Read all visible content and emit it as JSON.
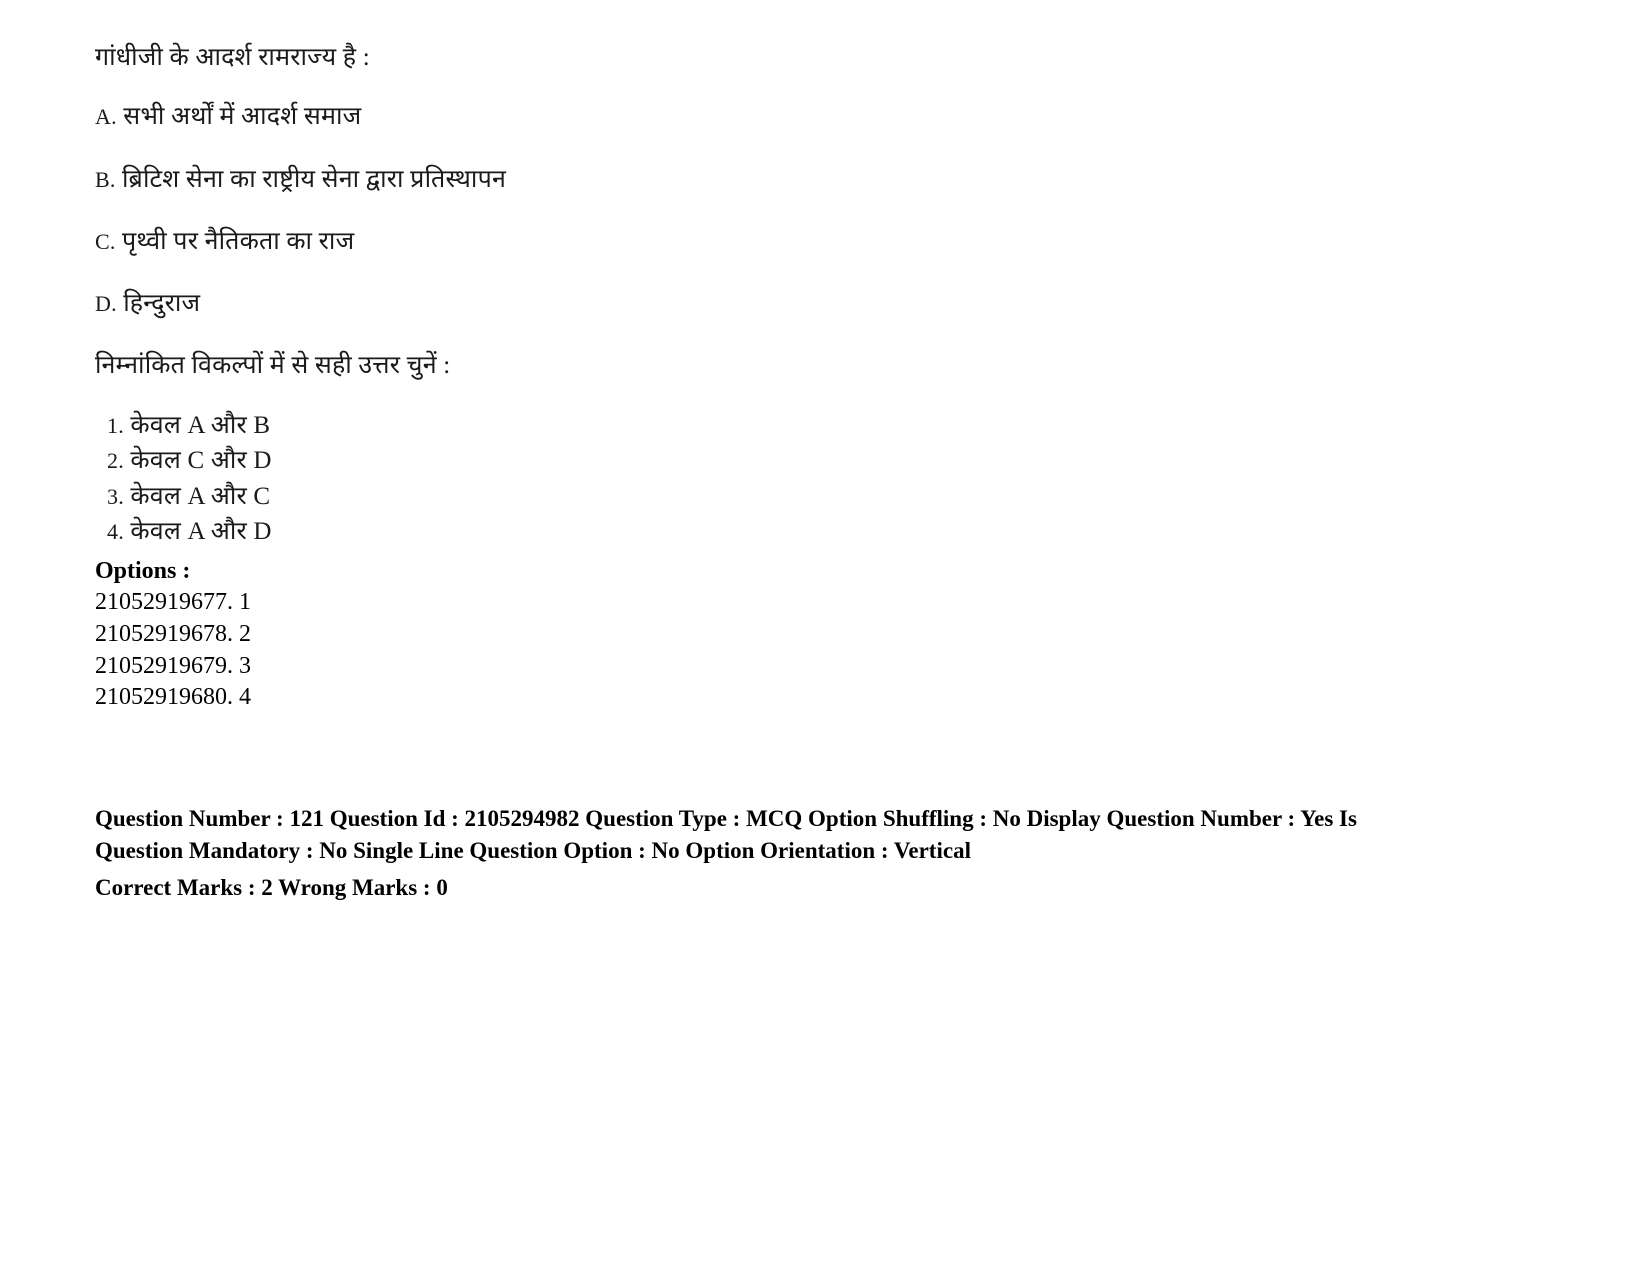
{
  "question": {
    "stem": "गांधीजी के आदर्श रामराज्य है  :",
    "statements": [
      {
        "label": "A.",
        "text": "सभी अर्थों में आदर्श समाज"
      },
      {
        "label": "B.",
        "text": "ब्रिटिश सेना का राष्ट्रीय सेना द्वारा प्रतिस्थापन"
      },
      {
        "label": "C.",
        "text": "पृथ्वी पर नैतिकता का राज"
      },
      {
        "label": "D.",
        "text": "हिन्दुराज"
      }
    ],
    "choose_instruction": "निम्नांकित विकल्पों में से सही उत्तर चुनें :",
    "alternatives": [
      {
        "num": "1.",
        "text": "केवल A और B"
      },
      {
        "num": "2.",
        "text": "केवल C और D"
      },
      {
        "num": "3.",
        "text": "केवल A और C"
      },
      {
        "num": "4.",
        "text": "केवल A और D"
      }
    ]
  },
  "options_block": {
    "heading": "Options :",
    "rows": [
      {
        "id": "21052919677.",
        "value": "1"
      },
      {
        "id": "21052919678.",
        "value": "2"
      },
      {
        "id": "21052919679.",
        "value": "3"
      },
      {
        "id": "21052919680.",
        "value": "4"
      }
    ]
  },
  "metadata": {
    "line1": "Question Number : 121 Question Id : 2105294982 Question Type : MCQ Option Shuffling : No Display Question Number : Yes Is",
    "line2": "Question Mandatory : No Single Line Question Option : No Option Orientation : Vertical",
    "line3": "Correct Marks : 2 Wrong Marks : 0"
  }
}
